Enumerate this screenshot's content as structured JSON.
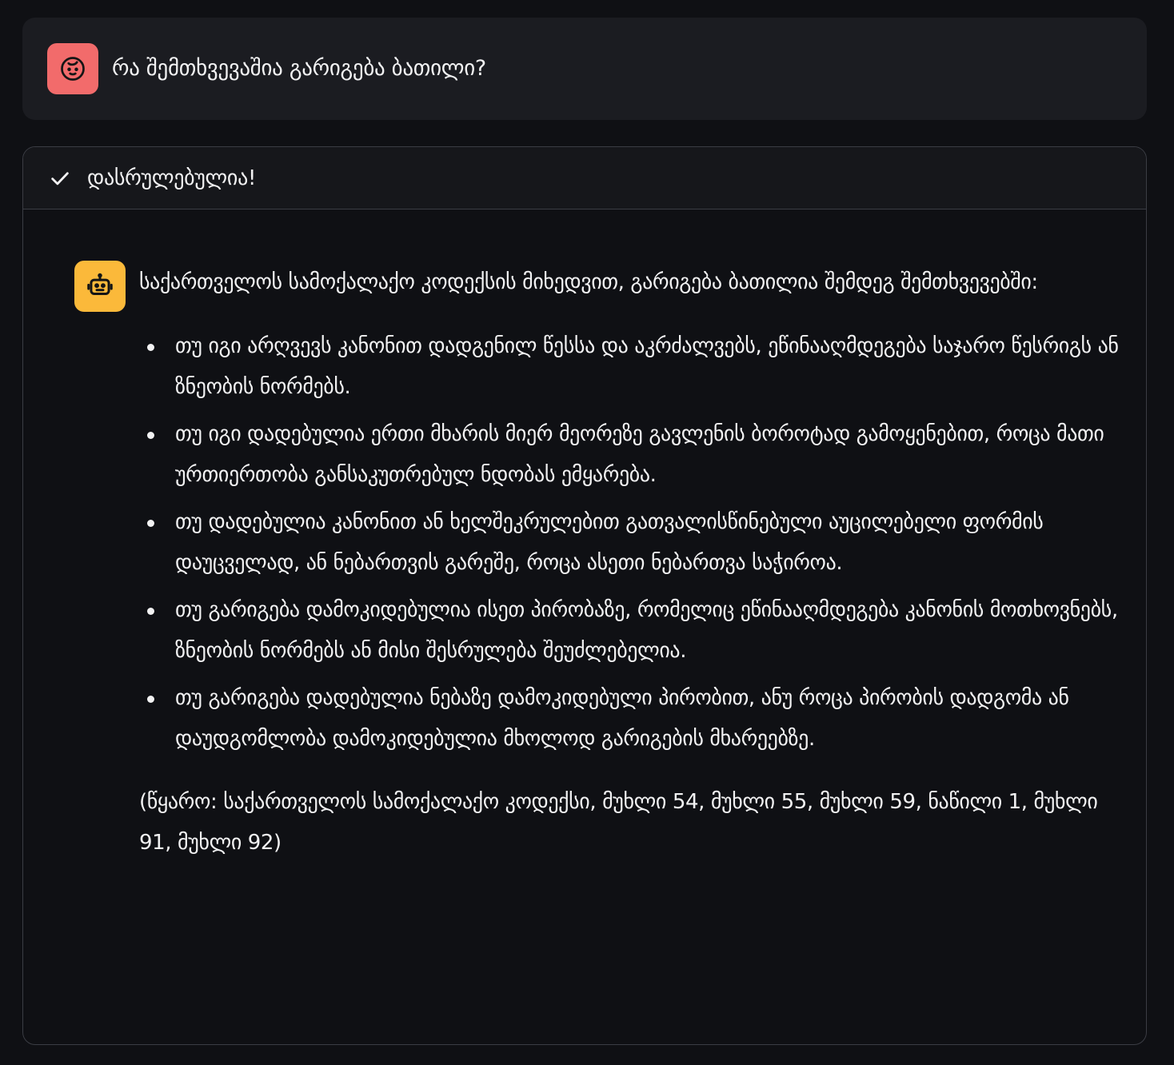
{
  "user_message": {
    "avatar_icon": "child-face-icon",
    "avatar_color": "#f26b6b",
    "text": "რა შემთხვევაშია გარიგება ბათილი?"
  },
  "response": {
    "status_icon": "check-icon",
    "status_text": "დასრულებულია!",
    "avatar_icon": "robot-icon",
    "avatar_color": "#fbb93a",
    "intro": "საქართველოს სამოქალაქო კოდექსის მიხედვით, გარიგება ბათილია შემდეგ შემთხვევებში:",
    "items": [
      "თუ იგი არღვევს კანონით დადგენილ წესსა და აკრძალვებს, ეწინააღმდეგება საჯარო წესრიგს ან ზნეობის ნორმებს.",
      "თუ იგი დადებულია ერთი მხარის მიერ მეორეზე გავლენის ბოროტად გამოყენებით, როცა მათი ურთიერთობა განსაკუთრებულ ნდობას ემყარება.",
      "თუ დადებულია კანონით ან ხელშეკრულებით გათვალისწინებული აუცილებელი ფორმის დაუცველად, ან ნებართვის გარეშე, როცა ასეთი ნებართვა საჭიროა.",
      "თუ გარიგება დამოკიდებულია ისეთ პირობაზე, რომელიც ეწინააღმდეგება კანონის მოთხოვნებს, ზნეობის ნორმებს ან მისი შესრულება შეუძლებელია.",
      "თუ გარიგება დადებულია ნებაზე დამოკიდებული პირობით, ანუ როცა პირობის დადგომა ან დაუდგომლობა დამოკიდებულია მხოლოდ გარიგების მხარეებზე."
    ],
    "source": "(წყარო: საქართველოს სამოქალაქო კოდექსი, მუხლი 54, მუხლი 55, მუხლი 59, ნაწილი 1, მუხლი 91, მუხლი 92)"
  }
}
